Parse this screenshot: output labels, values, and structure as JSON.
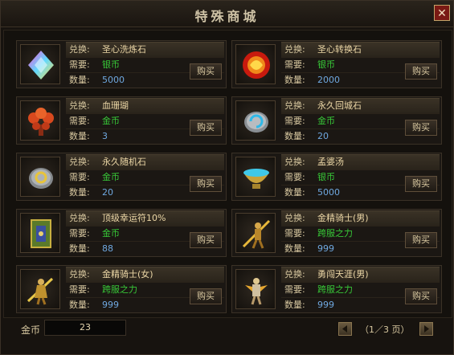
{
  "window": {
    "title": "特殊商城",
    "close_label": "✕"
  },
  "labels": {
    "exchange": "兑换:",
    "require": "需要:",
    "quantity": "数量:",
    "buy": "购买"
  },
  "items": [
    {
      "name": "圣心洗炼石",
      "currency": "银币",
      "quantity": "5000",
      "icon": "rainbow-crystal-icon"
    },
    {
      "name": "圣心转换石",
      "currency": "银币",
      "quantity": "2000",
      "icon": "fire-orb-icon"
    },
    {
      "name": "血珊瑚",
      "currency": "金币",
      "quantity": "3",
      "icon": "red-coral-icon"
    },
    {
      "name": "永久回城石",
      "currency": "金币",
      "quantity": "20",
      "icon": "return-stone-icon"
    },
    {
      "name": "永久随机石",
      "currency": "金币",
      "quantity": "20",
      "icon": "random-stone-icon"
    },
    {
      "name": "孟婆汤",
      "currency": "银币",
      "quantity": "5000",
      "icon": "soup-bowl-icon"
    },
    {
      "name": "顶级幸运符10%",
      "currency": "金币",
      "quantity": "88",
      "icon": "luck-charm-icon"
    },
    {
      "name": "金精骑士(男)",
      "currency": "跨服之力",
      "quantity": "999",
      "icon": "golden-knight-male-icon"
    },
    {
      "name": "金精骑士(女)",
      "currency": "跨服之力",
      "quantity": "999",
      "icon": "golden-knight-female-icon"
    },
    {
      "name": "勇闯天涯(男)",
      "currency": "跨服之力",
      "quantity": "999",
      "icon": "adventurer-male-icon"
    }
  ],
  "footer": {
    "gold_label": "金币",
    "gold_value": "23",
    "page_text": "（1／3 页）"
  },
  "colors": {
    "currency": "#38c838",
    "quantity": "#6fa8e0",
    "name": "#ecd7a6"
  }
}
